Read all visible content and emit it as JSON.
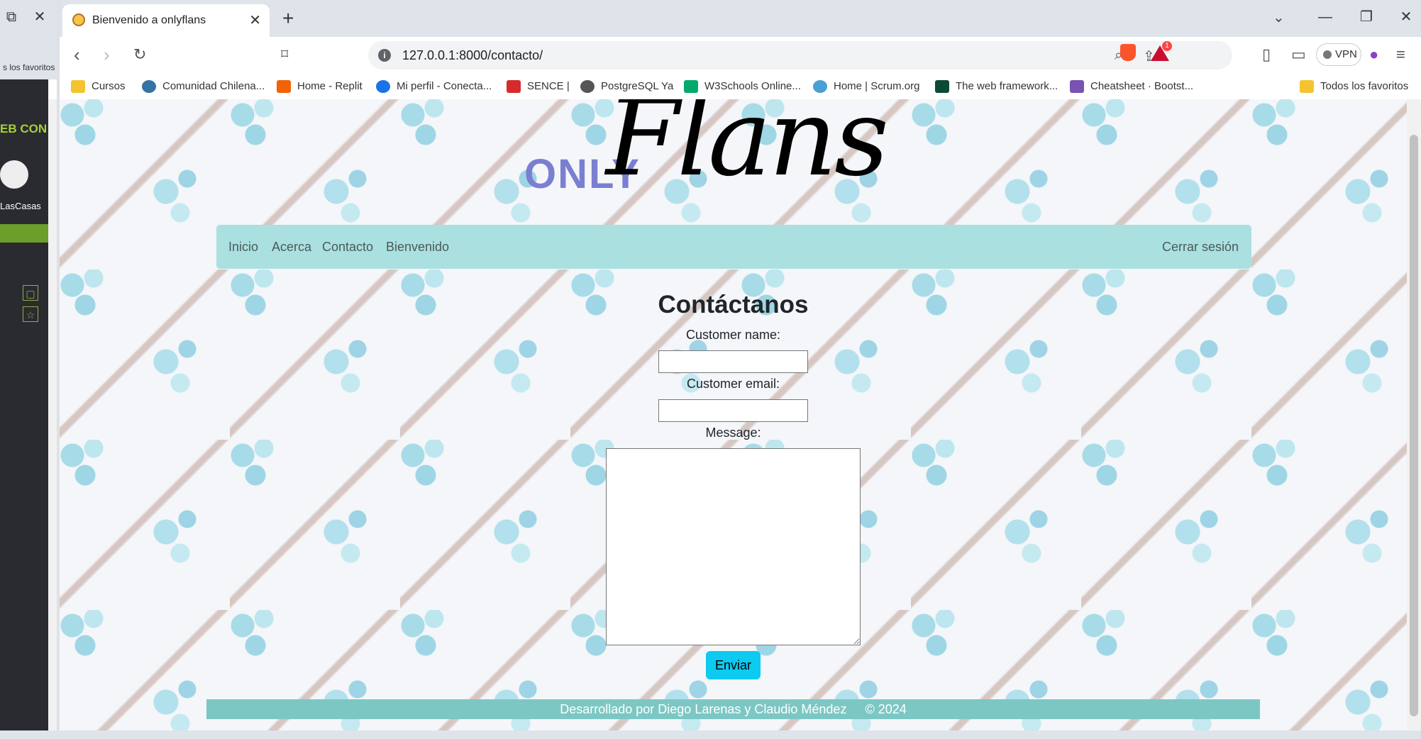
{
  "browser": {
    "tab_title": "Bienvenido a onlyflans",
    "url": "127.0.0.1:8000/contacto/",
    "vpn_label": "VPN",
    "alert_count": "1",
    "bookmarks": [
      {
        "label": "Cursos",
        "icon": "folder-icon",
        "color": "#f4c430"
      },
      {
        "label": "Comunidad Chilena...",
        "icon": "python-icon",
        "color": "#3572a5"
      },
      {
        "label": "Home - Replit",
        "icon": "replit-icon",
        "color": "#f26207"
      },
      {
        "label": "Mi perfil - Conecta...",
        "icon": "t-icon",
        "color": "#1a73e8"
      },
      {
        "label": "SENCE |",
        "icon": "sence-icon",
        "color": "#d62b2b"
      },
      {
        "label": "PostgreSQL Ya",
        "icon": "globe-icon",
        "color": "#555555"
      },
      {
        "label": "W3Schools Online...",
        "icon": "w3-icon",
        "color": "#04aa6d"
      },
      {
        "label": "Home | Scrum.org",
        "icon": "scrum-icon",
        "color": "#4a9fd5"
      },
      {
        "label": "The web framework...",
        "icon": "django-icon",
        "color": "#0c4b33"
      },
      {
        "label": "Cheatsheet · Bootst...",
        "icon": "bootstrap-icon",
        "color": "#7952b3"
      }
    ],
    "all_bookmarks": "Todos los favoritos"
  },
  "left_panel": {
    "favorites_text": "s los favoritos",
    "green_text": "EB CON",
    "user": "LasCasas"
  },
  "site": {
    "logo_only": "ONLY",
    "logo_flans": "Flans",
    "nav": {
      "inicio": "Inicio",
      "acerca": "Acerca",
      "contacto": "Contacto",
      "bienvenido": "Bienvenido",
      "logout": "Cerrar sesión"
    },
    "form": {
      "title": "Contáctanos",
      "name_label": "Customer name:",
      "email_label": "Customer email:",
      "message_label": "Message:",
      "name_value": "",
      "email_value": "",
      "message_value": "",
      "submit": "Enviar"
    },
    "footer": {
      "credit": "Desarrollado por Diego Larenas y Claudio Méndez",
      "year": "© 2024"
    }
  },
  "colors": {
    "navbar": "#abe0e0",
    "button": "#0dcaf0",
    "footer": "#7cc7c4",
    "logo_only": "#7b7fd0"
  }
}
